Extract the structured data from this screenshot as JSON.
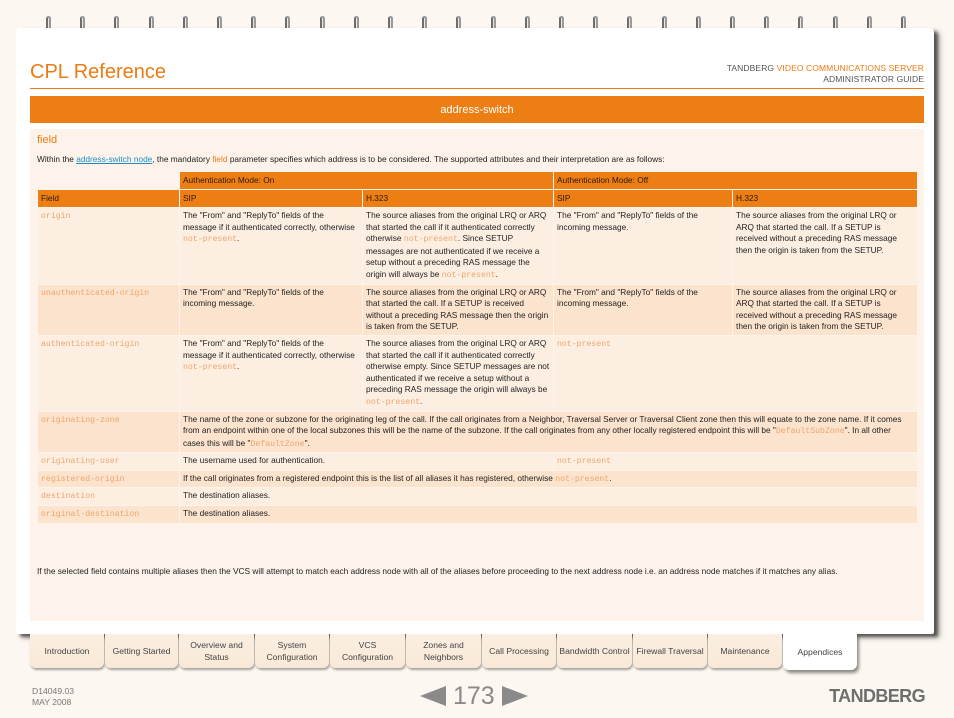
{
  "header": {
    "title": "CPL Reference",
    "brand_prefix": "TANDBERG",
    "brand_product": "VIDEO COMMUNICATIONS SERVER",
    "guide": "ADMINISTRATOR GUIDE"
  },
  "section": {
    "title": "address-switch",
    "subheading": "field",
    "intro_before_link": "Within the ",
    "intro_link": "address-switch node",
    "intro_middle": ", the mandatory ",
    "intro_keyword": "field",
    "intro_after": " parameter specifies which address is to be considered.  The supported attributes and their interpretation are as follows:",
    "outro": "If the selected field contains multiple aliases then the VCS will attempt to match each address node with all of the aliases before proceeding to the next address node i.e. an address node matches if it matches any alias."
  },
  "table": {
    "group_headers": [
      "Authentication Mode: On",
      "Authentication Mode: Off"
    ],
    "column_headers": [
      "Field",
      "SIP",
      "H.323",
      "SIP",
      "H.323"
    ],
    "rows": [
      {
        "field": "origin",
        "on_sip": [
          {
            "t": "The \"From\" and \"ReplyTo\" fields of the message if it authenticated correctly, otherwise "
          },
          {
            "c": "not-present"
          },
          {
            "t": "."
          }
        ],
        "on_h323": [
          {
            "t": "The source aliases from the original LRQ or ARQ that started the call if it authenticated correctly otherwise "
          },
          {
            "c": "not-present"
          },
          {
            "t": ". Since SETUP messages are not authenticated if we receive a setup without a preceding RAS message the origin will always be "
          },
          {
            "c": "not-present"
          },
          {
            "t": "."
          }
        ],
        "off_sip": [
          {
            "t": "The \"From\" and \"ReplyTo\" fields of the incoming message."
          }
        ],
        "off_h323": [
          {
            "t": "The source aliases from the original LRQ or ARQ that started the call. If a SETUP is received without a preceding RAS message then the origin is taken from the SETUP."
          }
        ]
      },
      {
        "field": "unauthenticated-origin",
        "on_sip": [
          {
            "t": "The \"From\" and \"ReplyTo\" fields of the incoming message."
          }
        ],
        "on_h323": [
          {
            "t": "The source aliases from the original LRQ or ARQ that started the call. If a SETUP is received without a preceding RAS message then the origin is taken from the SETUP."
          }
        ],
        "off_sip": [
          {
            "t": "The \"From\" and \"ReplyTo\" fields of the incoming message."
          }
        ],
        "off_h323": [
          {
            "t": "The source aliases from the original LRQ or ARQ that started the call. If a SETUP is received without a preceding RAS message then the origin is taken from the SETUP."
          }
        ]
      },
      {
        "field": "authenticated-origin",
        "on_sip": [
          {
            "t": "The \"From\" and \"ReplyTo\" fields of the message if it authenticated correctly, otherwise "
          },
          {
            "c": "not-present"
          },
          {
            "t": "."
          }
        ],
        "on_h323": [
          {
            "t": "The source aliases from the original LRQ or ARQ that started the call if it authenticated correctly otherwise empty. Since SETUP messages are not authenticated if we receive a setup without a preceding RAS message the origin will always be "
          },
          {
            "c": "not-present"
          },
          {
            "t": "."
          }
        ],
        "off_span": [
          {
            "c": "not-present"
          }
        ]
      },
      {
        "field": "originating-zone",
        "full_span": [
          {
            "t": "The name of the zone or subzone for the originating leg of the call. If the call originates from a Neighbor, Traversal Server or Traversal Client zone then this will equate to the zone name. If it comes from an endpoint within one of the local subzones this will be the name of the subzone. If the call originates from any other locally registered endpoint this will be \""
          },
          {
            "c": "DefaultSubZone"
          },
          {
            "t": "\". In all other cases this will be \""
          },
          {
            "c": "DefaultZone"
          },
          {
            "t": "\"."
          }
        ]
      },
      {
        "field": "originating-user",
        "on_span": [
          {
            "t": "The username used for authentication."
          }
        ],
        "off_span": [
          {
            "c": "not-present"
          }
        ]
      },
      {
        "field": "registered-origin",
        "full_span": [
          {
            "t": "If the call originates from a registered endpoint this is the list of all aliases it has registered, otherwise "
          },
          {
            "c": "not-present"
          },
          {
            "t": "."
          }
        ]
      },
      {
        "field": "destination",
        "full_span": [
          {
            "t": "The destination aliases."
          }
        ]
      },
      {
        "field": "original-destination",
        "full_span": [
          {
            "t": "The destination aliases."
          }
        ]
      }
    ]
  },
  "tabs": [
    {
      "label": "Introduction",
      "active": false
    },
    {
      "label": "Getting Started",
      "active": false
    },
    {
      "label": "Overview and Status",
      "active": false
    },
    {
      "label": "System Configuration",
      "active": false
    },
    {
      "label": "VCS Configuration",
      "active": false
    },
    {
      "label": "Zones and Neighbors",
      "active": false
    },
    {
      "label": "Call Processing",
      "active": false
    },
    {
      "label": "Bandwidth Control",
      "active": false
    },
    {
      "label": "Firewall Traversal",
      "active": false
    },
    {
      "label": "Maintenance",
      "active": false
    },
    {
      "label": "Appendices",
      "active": true
    }
  ],
  "footer": {
    "doc_id": "D14049.03",
    "date": "MAY 2008",
    "page_number": "173",
    "logo": "TANDBERG"
  },
  "colors": {
    "accent": "#ec7e14",
    "code": "#f0a56a",
    "link": "#1f8dc8"
  }
}
